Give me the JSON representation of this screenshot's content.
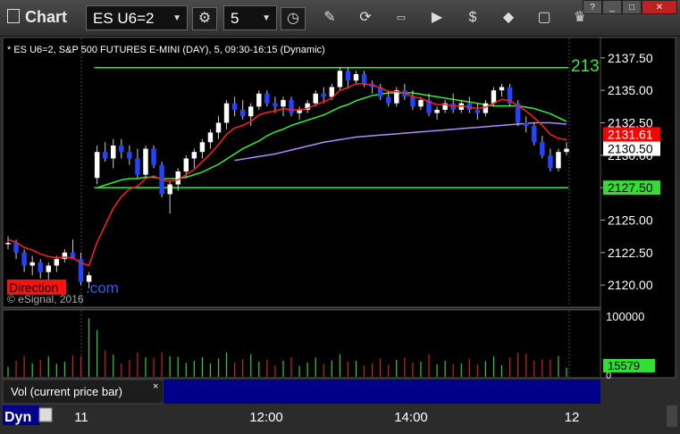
{
  "app": {
    "title": "Chart"
  },
  "toolbar": {
    "symbol": "ES U6=2",
    "interval": "5"
  },
  "window_buttons": [
    "?",
    "_",
    "□",
    "✕"
  ],
  "chart": {
    "header": "* ES U6=2, S&P 500 FUTURES E-MINI (DAY), 5, 09:30-16:15 (Dynamic)",
    "top_line_label": "213",
    "copyright": "© eSignal, 2016",
    "watermark": "DirectionalTrader.com",
    "watermark_a": "Direction",
    "watermark_b": ".com",
    "price_ticks": [
      "2137.50",
      "2135.00",
      "2132.50",
      "2130.00",
      "2127.50",
      "2125.00",
      "2122.50",
      "2120.00"
    ],
    "price_tags": [
      {
        "text": "2131.61",
        "bg": "#ff0000",
        "fg": "#ffffff"
      },
      {
        "text": "2130.50",
        "bg": "#ffffff",
        "fg": "#000000"
      },
      {
        "text": "2127.50",
        "bg": "#33dd33",
        "fg": "#000000"
      }
    ],
    "vol_ticks": [
      "100000",
      "0"
    ],
    "vol_tag": "15579",
    "vol_legend": "Vol (current price bar)",
    "vol_close": "×",
    "x_ticks": [
      "11",
      "12:00",
      "14:00",
      "12"
    ],
    "dyn_label": "Dyn",
    "colors": {
      "up": "#ffffff",
      "down": "#2244ff",
      "ema_fast": "#ff2020",
      "ema_slow": "#33ee33",
      "vwap": "#b48cff",
      "hline": "#33ee33",
      "vol_up": "#33cc33",
      "vol_down": "#cc2222"
    }
  },
  "chart_data": {
    "type": "candlestick",
    "title": "ES U6=2, S&P 500 FUTURES E-MINI (DAY), 5, 09:30-16:15 (Dynamic)",
    "ylim": [
      2118.5,
      2139.0
    ],
    "vol_ylim": [
      0,
      110000
    ],
    "horizontal_lines": [
      2136.75,
      2127.5
    ],
    "candles": [
      [
        2123.25,
        2123.75,
        2122.75,
        2123.25
      ],
      [
        2123.25,
        2123.5,
        2122.0,
        2122.5
      ],
      [
        2122.5,
        2122.75,
        2121.0,
        2121.5
      ],
      [
        2121.5,
        2122.25,
        2120.75,
        2121.75
      ],
      [
        2121.75,
        2122.0,
        2120.5,
        2121.0
      ],
      [
        2121.0,
        2121.75,
        2120.25,
        2121.5
      ],
      [
        2121.5,
        2122.25,
        2121.0,
        2122.0
      ],
      [
        2122.0,
        2122.75,
        2121.75,
        2122.5
      ],
      [
        2122.5,
        2123.5,
        2122.0,
        2122.0
      ],
      [
        2122.0,
        2122.5,
        2120.0,
        2120.25
      ],
      [
        2120.25,
        2121.0,
        2119.75,
        2120.75
      ],
      [
        2128.25,
        2130.75,
        2127.75,
        2130.25
      ],
      [
        2130.25,
        2131.0,
        2129.5,
        2129.75
      ],
      [
        2129.75,
        2131.25,
        2129.0,
        2130.75
      ],
      [
        2130.75,
        2131.25,
        2129.75,
        2130.25
      ],
      [
        2130.25,
        2130.75,
        2129.25,
        2129.75
      ],
      [
        2129.75,
        2130.5,
        2128.25,
        2128.5
      ],
      [
        2128.5,
        2130.75,
        2128.25,
        2130.5
      ],
      [
        2130.5,
        2130.75,
        2129.0,
        2129.25
      ],
      [
        2129.25,
        2129.5,
        2126.75,
        2127.0
      ],
      [
        2127.0,
        2128.0,
        2125.5,
        2127.75
      ],
      [
        2127.75,
        2129.0,
        2127.25,
        2128.75
      ],
      [
        2128.75,
        2130.0,
        2128.25,
        2129.75
      ],
      [
        2129.75,
        2130.5,
        2129.0,
        2130.25
      ],
      [
        2130.25,
        2131.25,
        2129.75,
        2131.0
      ],
      [
        2131.0,
        2132.0,
        2130.5,
        2131.75
      ],
      [
        2131.75,
        2133.0,
        2131.25,
        2132.5
      ],
      [
        2132.5,
        2134.25,
        2132.0,
        2134.0
      ],
      [
        2134.0,
        2134.5,
        2133.0,
        2133.5
      ],
      [
        2133.5,
        2134.25,
        2132.75,
        2133.0
      ],
      [
        2133.0,
        2134.0,
        2132.25,
        2133.75
      ],
      [
        2133.75,
        2135.0,
        2133.5,
        2134.75
      ],
      [
        2134.75,
        2135.0,
        2133.75,
        2134.0
      ],
      [
        2134.0,
        2134.5,
        2133.25,
        2133.75
      ],
      [
        2133.75,
        2134.5,
        2133.0,
        2134.25
      ],
      [
        2134.25,
        2134.5,
        2133.0,
        2133.25
      ],
      [
        2133.25,
        2133.75,
        2132.75,
        2133.5
      ],
      [
        2133.5,
        2134.25,
        2133.25,
        2134.0
      ],
      [
        2134.0,
        2135.0,
        2133.75,
        2134.75
      ],
      [
        2134.75,
        2135.25,
        2134.0,
        2134.5
      ],
      [
        2134.5,
        2135.5,
        2134.25,
        2135.25
      ],
      [
        2135.25,
        2136.75,
        2135.0,
        2136.5
      ],
      [
        2136.5,
        2136.75,
        2135.25,
        2135.75
      ],
      [
        2135.75,
        2136.5,
        2135.5,
        2136.25
      ],
      [
        2136.25,
        2136.5,
        2135.25,
        2135.5
      ],
      [
        2135.5,
        2135.75,
        2134.75,
        2135.25
      ],
      [
        2135.25,
        2135.5,
        2134.25,
        2134.5
      ],
      [
        2134.5,
        2135.0,
        2133.75,
        2134.0
      ],
      [
        2134.0,
        2135.25,
        2133.75,
        2135.0
      ],
      [
        2135.0,
        2135.5,
        2134.25,
        2134.5
      ],
      [
        2134.5,
        2135.0,
        2133.5,
        2133.75
      ],
      [
        2133.75,
        2134.5,
        2133.5,
        2134.25
      ],
      [
        2134.25,
        2134.75,
        2133.0,
        2133.25
      ],
      [
        2133.25,
        2133.75,
        2132.75,
        2133.5
      ],
      [
        2133.5,
        2134.25,
        2133.25,
        2134.0
      ],
      [
        2134.0,
        2134.75,
        2133.25,
        2133.5
      ],
      [
        2133.5,
        2134.25,
        2133.25,
        2134.0
      ],
      [
        2134.0,
        2134.5,
        2133.25,
        2133.5
      ],
      [
        2133.5,
        2134.0,
        2132.75,
        2133.25
      ],
      [
        2133.25,
        2134.25,
        2133.0,
        2134.0
      ],
      [
        2134.0,
        2135.25,
        2133.75,
        2135.0
      ],
      [
        2135.0,
        2135.5,
        2134.5,
        2135.25
      ],
      [
        2135.25,
        2135.5,
        2133.75,
        2134.0
      ],
      [
        2134.0,
        2134.25,
        2132.25,
        2132.5
      ],
      [
        2132.5,
        2133.0,
        2131.75,
        2132.25
      ],
      [
        2132.25,
        2132.5,
        2130.75,
        2131.0
      ],
      [
        2131.0,
        2131.5,
        2129.75,
        2130.0
      ],
      [
        2130.0,
        2130.5,
        2128.75,
        2129.0
      ],
      [
        2129.0,
        2130.5,
        2128.75,
        2130.25
      ],
      [
        2130.25,
        2131.0,
        2130.0,
        2130.5
      ]
    ],
    "ema_fast": [
      2123.5,
      2123.3,
      2122.9,
      2122.7,
      2122.4,
      2122.2,
      2122.1,
      2122.15,
      2122.1,
      2121.7,
      2121.5,
      2123.3,
      2124.6,
      2125.9,
      2126.8,
      2127.4,
      2127.6,
      2128.2,
      2128.4,
      2128.1,
      2128.0,
      2128.1,
      2128.5,
      2128.9,
      2129.5,
      2130.1,
      2130.8,
      2131.6,
      2132.1,
      2132.3,
      2132.6,
      2133.1,
      2133.3,
      2133.4,
      2133.6,
      2133.5,
      2133.5,
      2133.6,
      2133.9,
      2134.1,
      2134.4,
      2135.0,
      2135.2,
      2135.5,
      2135.5,
      2135.4,
      2135.2,
      2134.9,
      2134.9,
      2134.8,
      2134.5,
      2134.4,
      2134.1,
      2133.9,
      2133.9,
      2133.8,
      2133.8,
      2133.7,
      2133.6,
      2133.7,
      2134.0,
      2134.3,
      2134.2,
      2133.8,
      2133.4,
      2132.9,
      2132.3,
      2131.6,
      2131.3,
      2131.2
    ],
    "ema_slow_start_index": 11,
    "ema_slow": [
      2127.5,
      2127.7,
      2127.9,
      2128.1,
      2128.2,
      2128.2,
      2128.3,
      2128.3,
      2128.2,
      2128.2,
      2128.2,
      2128.3,
      2128.5,
      2128.7,
      2129.0,
      2129.3,
      2129.7,
      2130.1,
      2130.5,
      2130.8,
      2131.1,
      2131.5,
      2131.8,
      2132.0,
      2132.3,
      2132.5,
      2132.7,
      2132.9,
      2133.1,
      2133.4,
      2133.7,
      2133.9,
      2134.2,
      2134.4,
      2134.6,
      2134.7,
      2134.8,
      2134.8,
      2134.8,
      2134.8,
      2134.7,
      2134.6,
      2134.5,
      2134.4,
      2134.3,
      2134.2,
      2134.1,
      2134.0,
      2133.9,
      2133.8,
      2133.8,
      2133.8,
      2133.8,
      2133.7,
      2133.6,
      2133.4,
      2133.2,
      2132.9,
      2132.6
    ]
  }
}
